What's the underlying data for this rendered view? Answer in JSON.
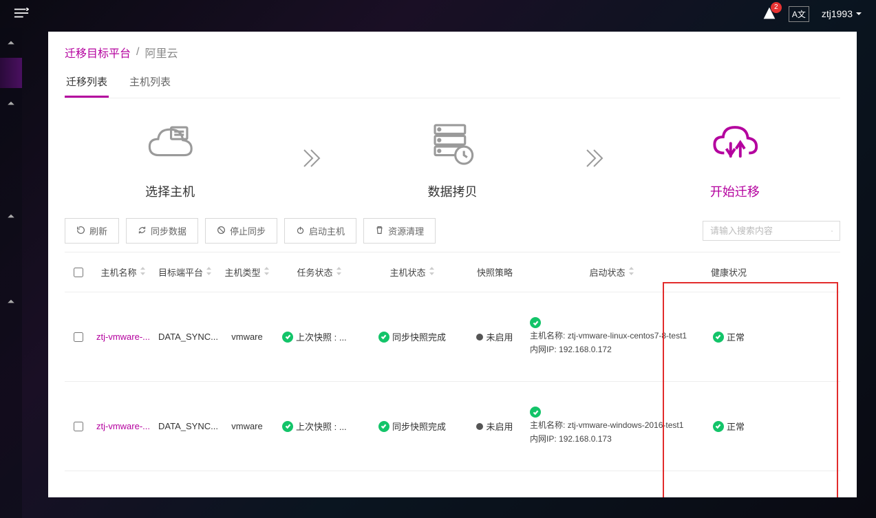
{
  "header": {
    "notification_count": "2",
    "language": "A文",
    "username": "ztj1993"
  },
  "breadcrumb": {
    "primary": "迁移目标平台",
    "separator": "/",
    "secondary": "阿里云"
  },
  "tabs": {
    "tab1": "迁移列表",
    "tab2": "主机列表"
  },
  "stepper": {
    "step1": "选择主机",
    "step2": "数据拷贝",
    "step3": "开始迁移"
  },
  "actions": {
    "refresh": "刷新",
    "sync": "同步数据",
    "stop": "停止同步",
    "start": "启动主机",
    "clean": "资源清理"
  },
  "search": {
    "placeholder": "请输入搜索内容"
  },
  "columns": {
    "host_name": "主机名称",
    "target_platform": "目标端平台",
    "host_type": "主机类型",
    "task_status": "任务状态",
    "host_status": "主机状态",
    "snapshot_policy": "快照策略",
    "boot_status": "启动状态",
    "health": "健康状况"
  },
  "rows": [
    {
      "host_name": "ztj-vmware-...",
      "target_platform": "DATA_SYNC...",
      "host_type": "vmware",
      "task_status": "上次快照 : ...",
      "host_status": "同步快照完成",
      "snapshot_policy": "未启用",
      "boot_hostname_label": "主机名称:",
      "boot_hostname": "ztj-vmware-linux-centos7-8-test1",
      "boot_ip_label": "内网IP:",
      "boot_ip": "192.168.0.172",
      "health": "正常"
    },
    {
      "host_name": "ztj-vmware-...",
      "target_platform": "DATA_SYNC...",
      "host_type": "vmware",
      "task_status": "上次快照 : ...",
      "host_status": "同步快照完成",
      "snapshot_policy": "未启用",
      "boot_hostname_label": "主机名称:",
      "boot_hostname": "ztj-vmware-windows-2016-test1",
      "boot_ip_label": "内网IP:",
      "boot_ip": "192.168.0.173",
      "health": "正常"
    }
  ]
}
